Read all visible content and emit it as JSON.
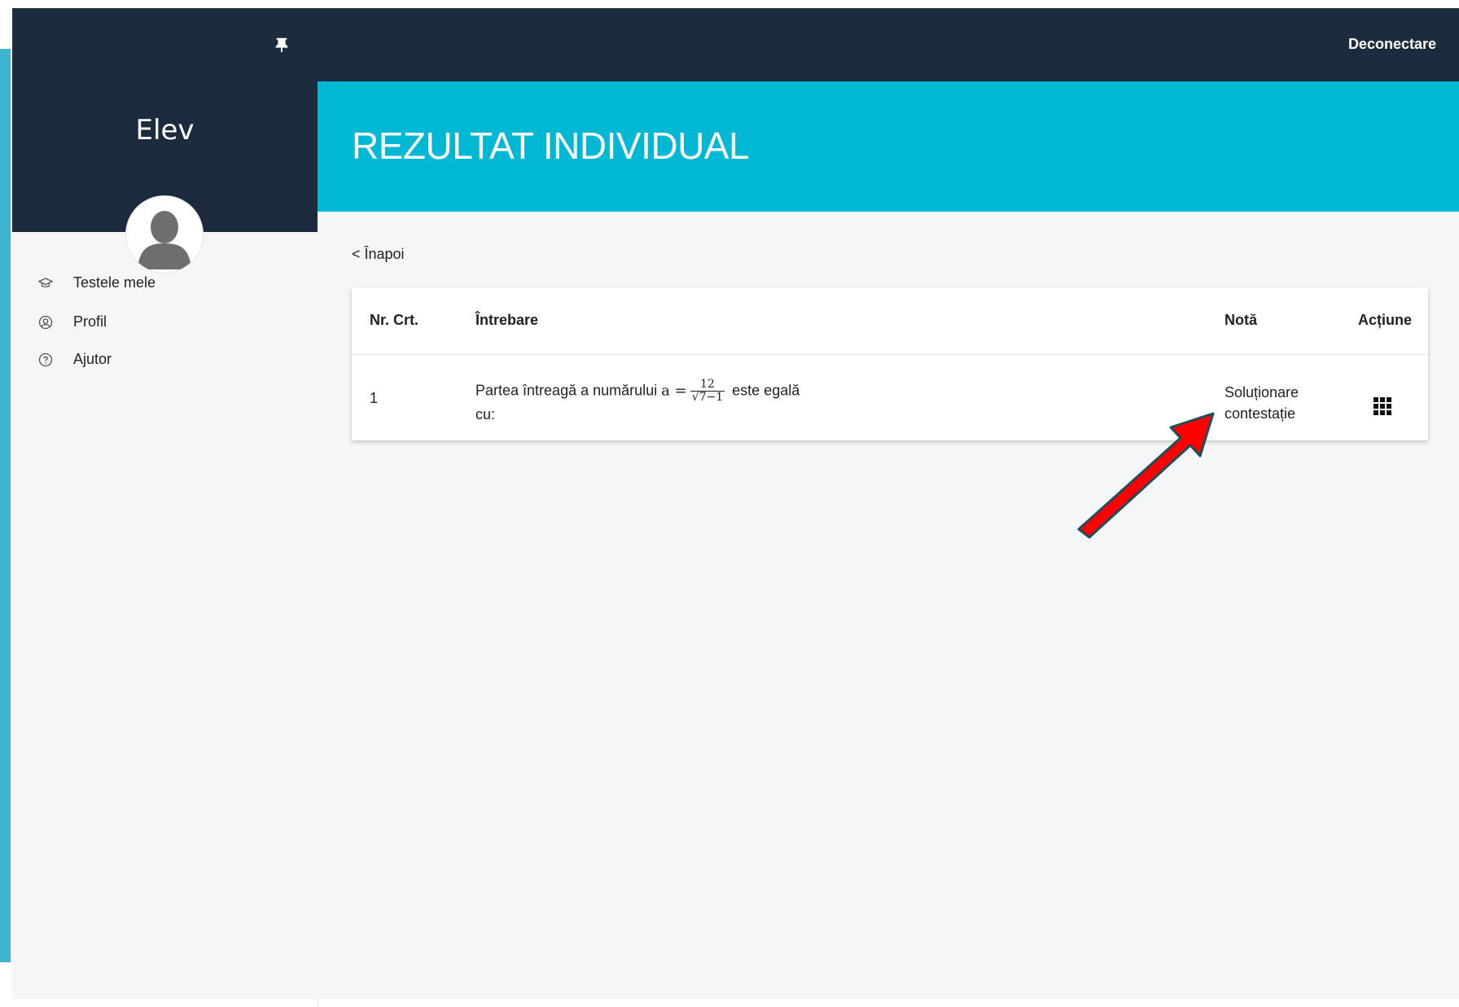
{
  "sidebar": {
    "title": "Elev",
    "items": [
      {
        "label": "Testele mele",
        "icon": "graduation-cap-icon"
      },
      {
        "label": "Profil",
        "icon": "user-circle-icon"
      },
      {
        "label": "Ajutor",
        "icon": "help-circle-icon"
      }
    ],
    "pin_icon": "pin-icon"
  },
  "topbar": {
    "logout_label": "Deconectare"
  },
  "page": {
    "title": "REZULTAT INDIVIDUAL",
    "back_label": "< Înapoi"
  },
  "table": {
    "headers": {
      "nr": "Nr. Crt.",
      "question": "Întrebare",
      "grade": "Notă",
      "action": "Acțiune"
    },
    "rows": [
      {
        "nr": "1",
        "question_before": "Partea întreagă a numărului ",
        "math_lhs": "a =",
        "frac_num": "12",
        "frac_den": "√7−1",
        "question_after": " este egală",
        "question_line2": "cu:",
        "grade_line1": "Soluționare",
        "grade_line2": "contestație",
        "action_icon": "grid-menu-icon"
      }
    ]
  },
  "colors": {
    "header_dark": "#1d2b3f",
    "banner_cyan": "#00b8d4",
    "background": "#f5f6f8",
    "annotation_arrow": "#ff0000"
  }
}
